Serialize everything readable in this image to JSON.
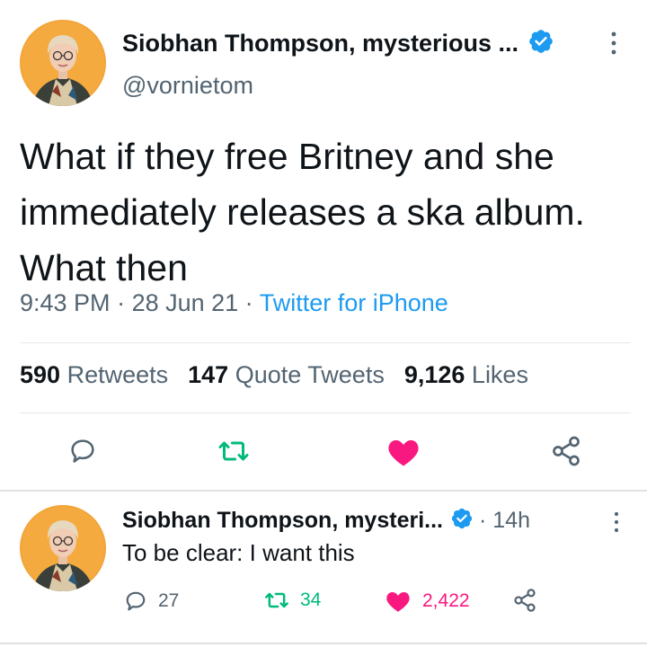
{
  "main_tweet": {
    "display_name": "Siobhan Thompson, mysterious ...",
    "handle": "@vornietom",
    "text": "What if they free Britney and she immediately releases a ska album. What then",
    "time": "9:43 PM",
    "date": "28 Jun 21",
    "source": "Twitter for iPhone",
    "separator": " · ",
    "stats": {
      "retweets_count": "590",
      "retweets_label": "Retweets",
      "quote_tweets_count": "147",
      "quote_tweets_label": "Quote Tweets",
      "likes_count": "9,126",
      "likes_label": "Likes"
    },
    "liked": true
  },
  "reply_tweet": {
    "display_name": "Siobhan Thompson, mysteri...",
    "time_ago": "· 14h",
    "text": "To be clear: I want this",
    "reply_count": "27",
    "retweet_count": "34",
    "like_count": "2,422",
    "liked": true,
    "retweeted": true
  },
  "icons": [
    "verified-badge-icon",
    "more-icon",
    "reply-icon",
    "retweet-icon",
    "heart-icon",
    "share-icon"
  ],
  "colors": {
    "text_primary": "#0f1419",
    "text_secondary": "#536471",
    "link_blue": "#1d9bf0",
    "verified_blue": "#1d9bf0",
    "like_pink": "#f91880",
    "retweet_green": "#00ba7c",
    "divider": "#e6e8ea"
  }
}
